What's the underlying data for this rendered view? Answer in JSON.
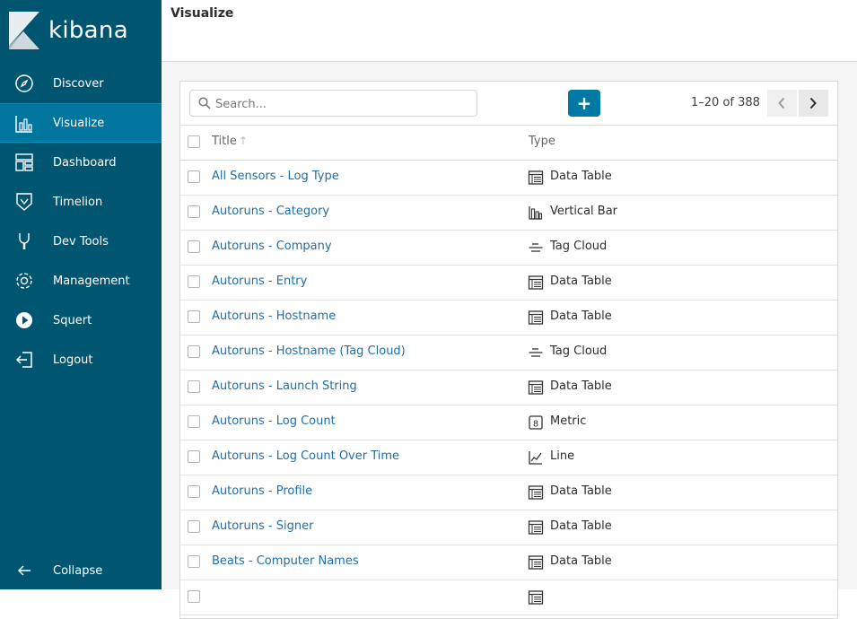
{
  "brand": {
    "name": "kibana"
  },
  "sidebar": {
    "items": [
      {
        "label": "Discover",
        "icon": "compass-icon"
      },
      {
        "label": "Visualize",
        "icon": "bar-chart-icon",
        "active": true
      },
      {
        "label": "Dashboard",
        "icon": "dashboard-icon"
      },
      {
        "label": "Timelion",
        "icon": "shield-icon"
      },
      {
        "label": "Dev Tools",
        "icon": "wrench-icon"
      },
      {
        "label": "Management",
        "icon": "gear-icon"
      },
      {
        "label": "Squert",
        "icon": "play-icon"
      },
      {
        "label": "Logout",
        "icon": "logout-icon"
      }
    ],
    "collapse_label": "Collapse"
  },
  "header": {
    "title": "Visualize"
  },
  "toolbar": {
    "search_placeholder": "Search...",
    "add_label": "+",
    "pager_text": "1–20 of 388"
  },
  "table": {
    "columns": {
      "title": "Title",
      "type": "Type"
    },
    "rows": [
      {
        "title": "All Sensors - Log Type",
        "type": "Data Table",
        "icon": "table-icon"
      },
      {
        "title": "Autoruns - Category",
        "type": "Vertical Bar",
        "icon": "vertical-bar-icon"
      },
      {
        "title": "Autoruns - Company",
        "type": "Tag Cloud",
        "icon": "tag-cloud-icon"
      },
      {
        "title": "Autoruns - Entry",
        "type": "Data Table",
        "icon": "table-icon"
      },
      {
        "title": "Autoruns - Hostname",
        "type": "Data Table",
        "icon": "table-icon"
      },
      {
        "title": "Autoruns - Hostname (Tag Cloud)",
        "type": "Tag Cloud",
        "icon": "tag-cloud-icon"
      },
      {
        "title": "Autoruns - Launch String",
        "type": "Data Table",
        "icon": "table-icon"
      },
      {
        "title": "Autoruns - Log Count",
        "type": "Metric",
        "icon": "metric-icon"
      },
      {
        "title": "Autoruns - Log Count Over Time",
        "type": "Line",
        "icon": "line-chart-icon"
      },
      {
        "title": "Autoruns - Profile",
        "type": "Data Table",
        "icon": "table-icon"
      },
      {
        "title": "Autoruns - Signer",
        "type": "Data Table",
        "icon": "table-icon"
      },
      {
        "title": "Beats - Computer Names",
        "type": "Data Table",
        "icon": "table-icon"
      },
      {
        "title": "",
        "type": "",
        "icon": "table-icon"
      }
    ]
  },
  "colors": {
    "sidebar": "#005571",
    "active": "#00769e",
    "link": "#1f6ea8",
    "primary": "#0079a5"
  }
}
